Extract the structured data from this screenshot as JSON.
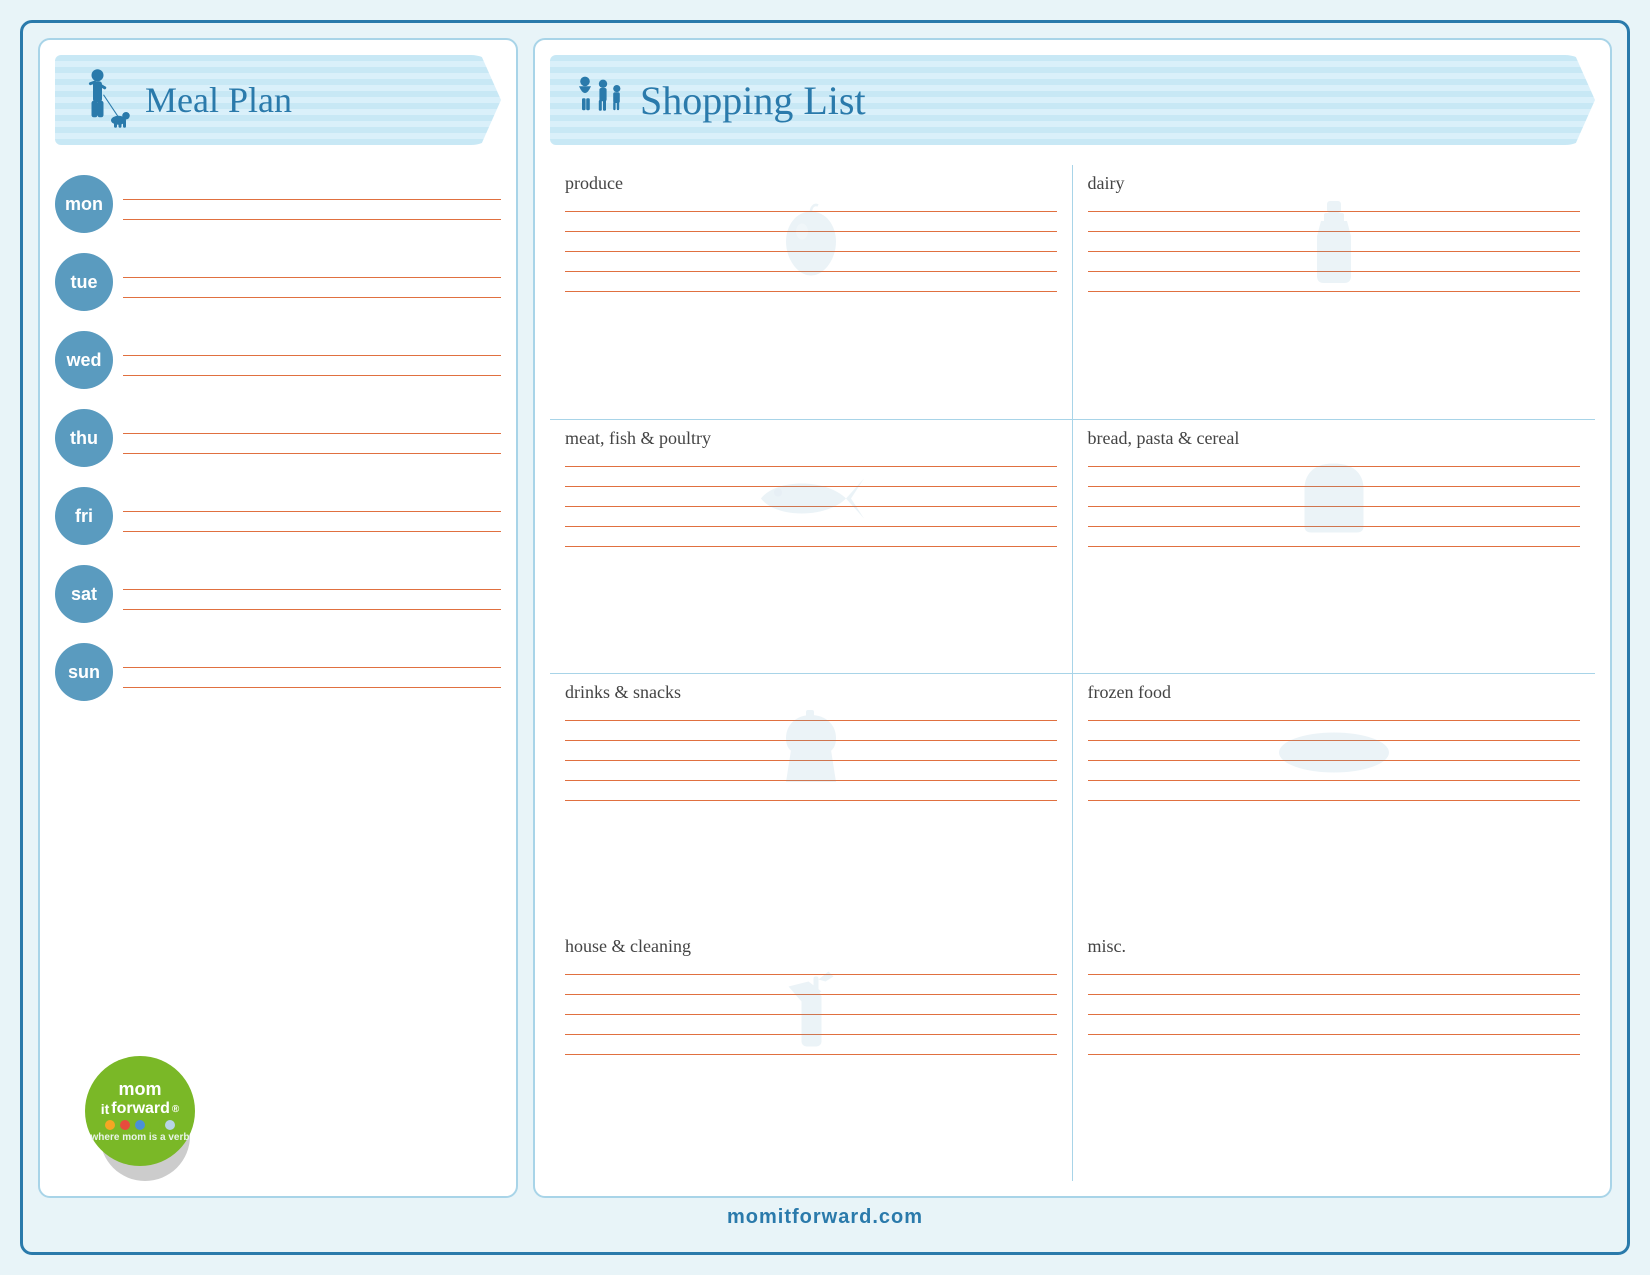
{
  "meal_plan": {
    "title": "Meal Plan",
    "days": [
      {
        "label": "mon",
        "lines": 2
      },
      {
        "label": "tue",
        "lines": 2
      },
      {
        "label": "wed",
        "lines": 2
      },
      {
        "label": "thu",
        "lines": 2
      },
      {
        "label": "fri",
        "lines": 2
      },
      {
        "label": "sat",
        "lines": 2
      },
      {
        "label": "sun",
        "lines": 2
      }
    ]
  },
  "shopping_list": {
    "title": "Shopping List",
    "sections": [
      {
        "id": "produce",
        "label": "produce",
        "icon": "apple"
      },
      {
        "id": "dairy",
        "label": "dairy",
        "icon": "bottle"
      },
      {
        "id": "meat",
        "label": "meat, fish & poultry",
        "icon": "fish"
      },
      {
        "id": "bread",
        "label": "bread, pasta & cereal",
        "icon": "bread"
      },
      {
        "id": "drinks",
        "label": "drinks & snacks",
        "icon": "cupcake"
      },
      {
        "id": "frozen",
        "label": "frozen food",
        "icon": "frozen"
      },
      {
        "id": "house",
        "label": "house & cleaning",
        "icon": "spray"
      },
      {
        "id": "misc",
        "label": "misc.",
        "icon": "misc"
      }
    ]
  },
  "footer": {
    "website": "momitforward.com"
  },
  "logo": {
    "line1": "mom",
    "line2": "it",
    "line3": "forward",
    "registered": "®",
    "tagline": "where mom is a verb",
    "dots": [
      "#f5a623",
      "#e84c3d",
      "#4a90d9",
      "#7ab827",
      "#b8d4e8"
    ]
  }
}
